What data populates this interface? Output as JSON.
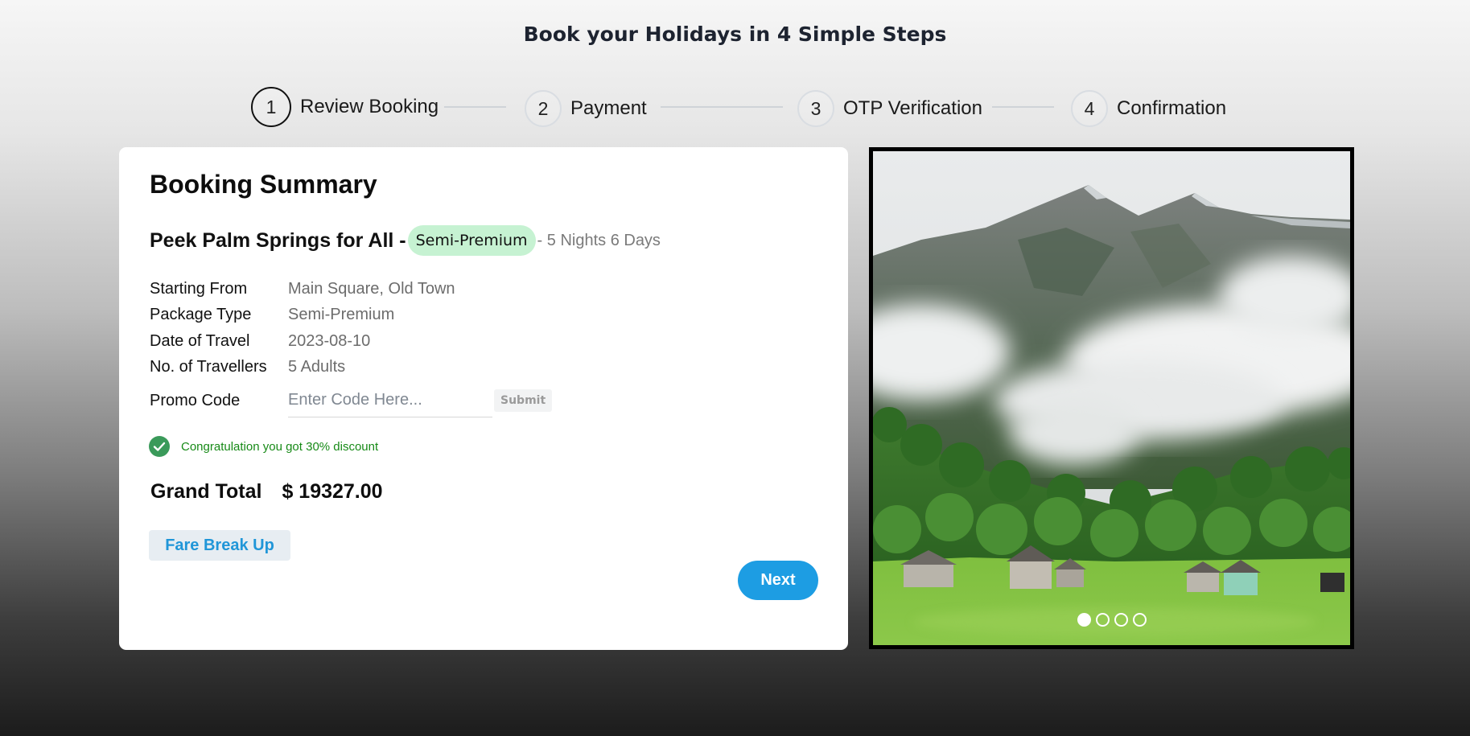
{
  "page": {
    "title": "Book your Holidays in 4 Simple Steps"
  },
  "stepper": {
    "steps": [
      {
        "number": "1",
        "label": "Review Booking",
        "active": true
      },
      {
        "number": "2",
        "label": "Payment",
        "active": false
      },
      {
        "number": "3",
        "label": "OTP Verification",
        "active": false
      },
      {
        "number": "4",
        "label": "Confirmation",
        "active": false
      }
    ]
  },
  "summary": {
    "title": "Booking Summary",
    "package_name": "Peek Palm Springs for All -",
    "package_badge": "Semi-Premium",
    "duration": "- 5 Nights 6 Days",
    "details": [
      {
        "label": "Starting From",
        "value": "Main Square, Old Town"
      },
      {
        "label": "Package Type",
        "value": "Semi-Premium"
      },
      {
        "label": "Date of Travel",
        "value": "2023-08-10"
      },
      {
        "label": "No. of Travellers",
        "value": "5 Adults"
      }
    ],
    "promo": {
      "label": "Promo Code",
      "placeholder": "Enter Code Here...",
      "value": "",
      "submit_label": "Submit"
    },
    "discount_message": "Congratulation you got 30% discount",
    "grand_total_label": "Grand Total",
    "grand_total_amount": "$ 19327.00",
    "fare_breakup_label": "Fare Break Up",
    "next_label": "Next"
  },
  "carousel": {
    "slide_count": 4,
    "active_index": 0
  },
  "colors": {
    "accent": "#1d9de3",
    "badge_bg": "#c6f2d2",
    "success": "#178a17",
    "check_icon": "#3a9a5a"
  },
  "icons": {
    "discount": "check-circle-icon"
  }
}
